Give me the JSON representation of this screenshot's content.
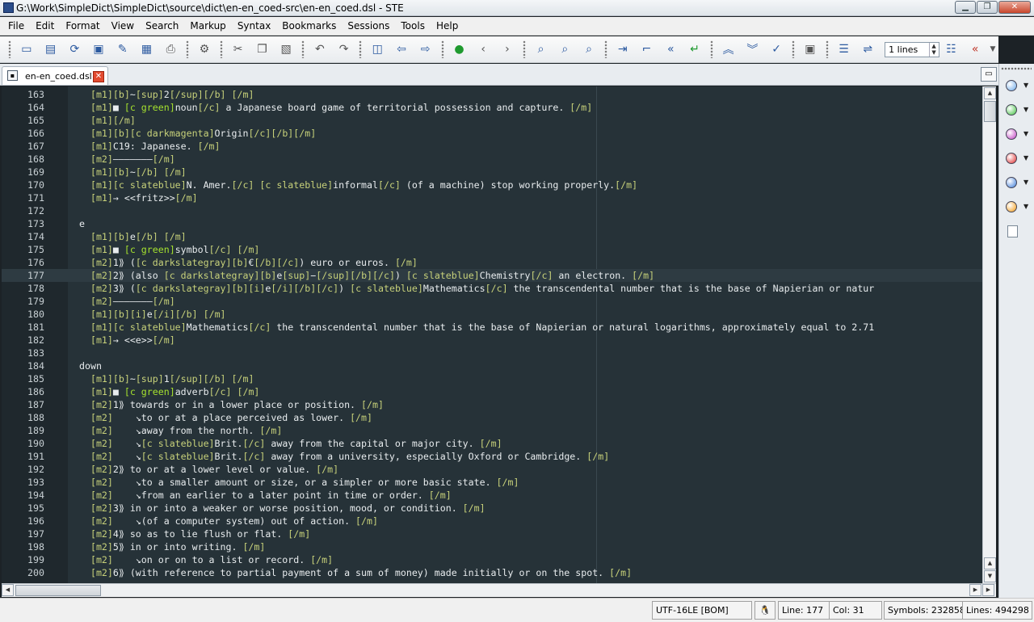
{
  "window": {
    "title": "G:\\Work\\SimpleDict\\SimpleDict\\source\\dict\\en-en_coed-src\\en-en_coed.dsl - STE"
  },
  "menu": [
    "File",
    "Edit",
    "Format",
    "View",
    "Search",
    "Markup",
    "Syntax",
    "Bookmarks",
    "Sessions",
    "Tools",
    "Help"
  ],
  "toolbar": {
    "lines_value": "1 lines"
  },
  "tab": {
    "label": "en-en_coed.dsl"
  },
  "status": {
    "encoding": "UTF-16LE [BOM]",
    "line": "Line: 177",
    "col": "Col: 31",
    "symbols": "Symbols: 23285856",
    "lines": "Lines: 494298"
  },
  "code_lines": [
    {
      "n": "163",
      "t": "  [m1][b]~[sup]2[/sup][/b] [/m]"
    },
    {
      "n": "164",
      "t": "  [m1]■ [c green]noun[/c] a Japanese board game of territorial possession and capture. [/m]"
    },
    {
      "n": "165",
      "t": "  [m1][/m]"
    },
    {
      "n": "166",
      "t": "  [m1][b][c darkmagenta]Origin[/c][/b][/m]"
    },
    {
      "n": "167",
      "t": "  [m1]C19: Japanese. [/m]"
    },
    {
      "n": "168",
      "t": "  [m2]———————[/m]"
    },
    {
      "n": "169",
      "t": "  [m1][b]~[/b] [/m]"
    },
    {
      "n": "170",
      "t": "  [m1][c slateblue]N. Amer.[/c] [c slateblue]informal[/c] (of a machine) stop working properly.[/m]"
    },
    {
      "n": "171",
      "t": "  [m1]→ <<fritz>>[/m]"
    },
    {
      "n": "172",
      "t": ""
    },
    {
      "n": "173",
      "t": "e"
    },
    {
      "n": "174",
      "t": "  [m1][b]e[/b] [/m]"
    },
    {
      "n": "175",
      "t": "  [m1]■ [c green]symbol[/c] [/m]"
    },
    {
      "n": "176",
      "t": "  [m2]1⟫ ([c darkslategray][b]€[/b][/c]) euro or euros. [/m]"
    },
    {
      "n": "177",
      "t": "  [m2]2⟫ (also [c darkslategray][b]e[sup]−[/sup][/b][/c]) [c slateblue]Chemistry[/c] an electron. [/m]"
    },
    {
      "n": "178",
      "t": "  [m2]3⟫ ([c darkslategray][b][i]e[/i][/b][/c]) [c slateblue]Mathematics[/c] the transcendental number that is the base of Napierian or natur"
    },
    {
      "n": "179",
      "t": "  [m2]———————[/m]"
    },
    {
      "n": "180",
      "t": "  [m1][b][i]e[/i][/b] [/m]"
    },
    {
      "n": "181",
      "t": "  [m1][c slateblue]Mathematics[/c] the transcendental number that is the base of Napierian or natural logarithms, approximately equal to 2.71"
    },
    {
      "n": "182",
      "t": "  [m1]→ <<e>>[/m]"
    },
    {
      "n": "183",
      "t": ""
    },
    {
      "n": "184",
      "t": "down"
    },
    {
      "n": "185",
      "t": "  [m1][b]~[sup]1[/sup][/b] [/m]"
    },
    {
      "n": "186",
      "t": "  [m1]■ [c green]adverb[/c] [/m]"
    },
    {
      "n": "187",
      "t": "  [m2]1⟫ towards or in a lower place or position. [/m]"
    },
    {
      "n": "188",
      "t": "  [m2]    ↘to or at a place perceived as lower. [/m]"
    },
    {
      "n": "189",
      "t": "  [m2]    ↘away from the north. [/m]"
    },
    {
      "n": "190",
      "t": "  [m2]    ↘[c slateblue]Brit.[/c] away from the capital or major city. [/m]"
    },
    {
      "n": "191",
      "t": "  [m2]    ↘[c slateblue]Brit.[/c] away from a university, especially Oxford or Cambridge. [/m]"
    },
    {
      "n": "192",
      "t": "  [m2]2⟫ to or at a lower level or value. [/m]"
    },
    {
      "n": "193",
      "t": "  [m2]    ↘to a smaller amount or size, or a simpler or more basic state. [/m]"
    },
    {
      "n": "194",
      "t": "  [m2]    ↘from an earlier to a later point in time or order. [/m]"
    },
    {
      "n": "195",
      "t": "  [m2]3⟫ in or into a weaker or worse position, mood, or condition. [/m]"
    },
    {
      "n": "196",
      "t": "  [m2]    ↘(of a computer system) out of action. [/m]"
    },
    {
      "n": "197",
      "t": "  [m2]4⟫ so as to lie flush or flat. [/m]"
    },
    {
      "n": "198",
      "t": "  [m2]5⟫ in or into writing. [/m]"
    },
    {
      "n": "199",
      "t": "  [m2]    ↘on or on to a list or record. [/m]"
    },
    {
      "n": "200",
      "t": "  [m2]6⟫ (with reference to partial payment of a sum of money) made initially or on the spot. [/m]"
    }
  ]
}
